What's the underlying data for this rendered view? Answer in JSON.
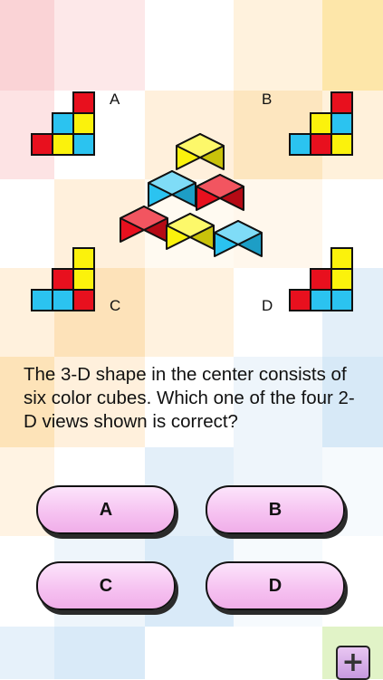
{
  "views": [
    {
      "label": "A"
    },
    {
      "label": "B"
    },
    {
      "label": "C"
    },
    {
      "label": "D"
    }
  ],
  "question": "The 3-D shape in the center consists of six color cubes. Which one of the four 2-D views shown is correct?",
  "answers": [
    {
      "label": "A"
    },
    {
      "label": "B"
    },
    {
      "label": "C"
    },
    {
      "label": "D"
    }
  ],
  "plus_button": "+",
  "colors": {
    "red": "#e8101e",
    "yellow": "#fbf20c",
    "blue": "#2bc3f0",
    "button_pink": "#f6c3f1"
  },
  "icons": [
    "plus-icon"
  ]
}
